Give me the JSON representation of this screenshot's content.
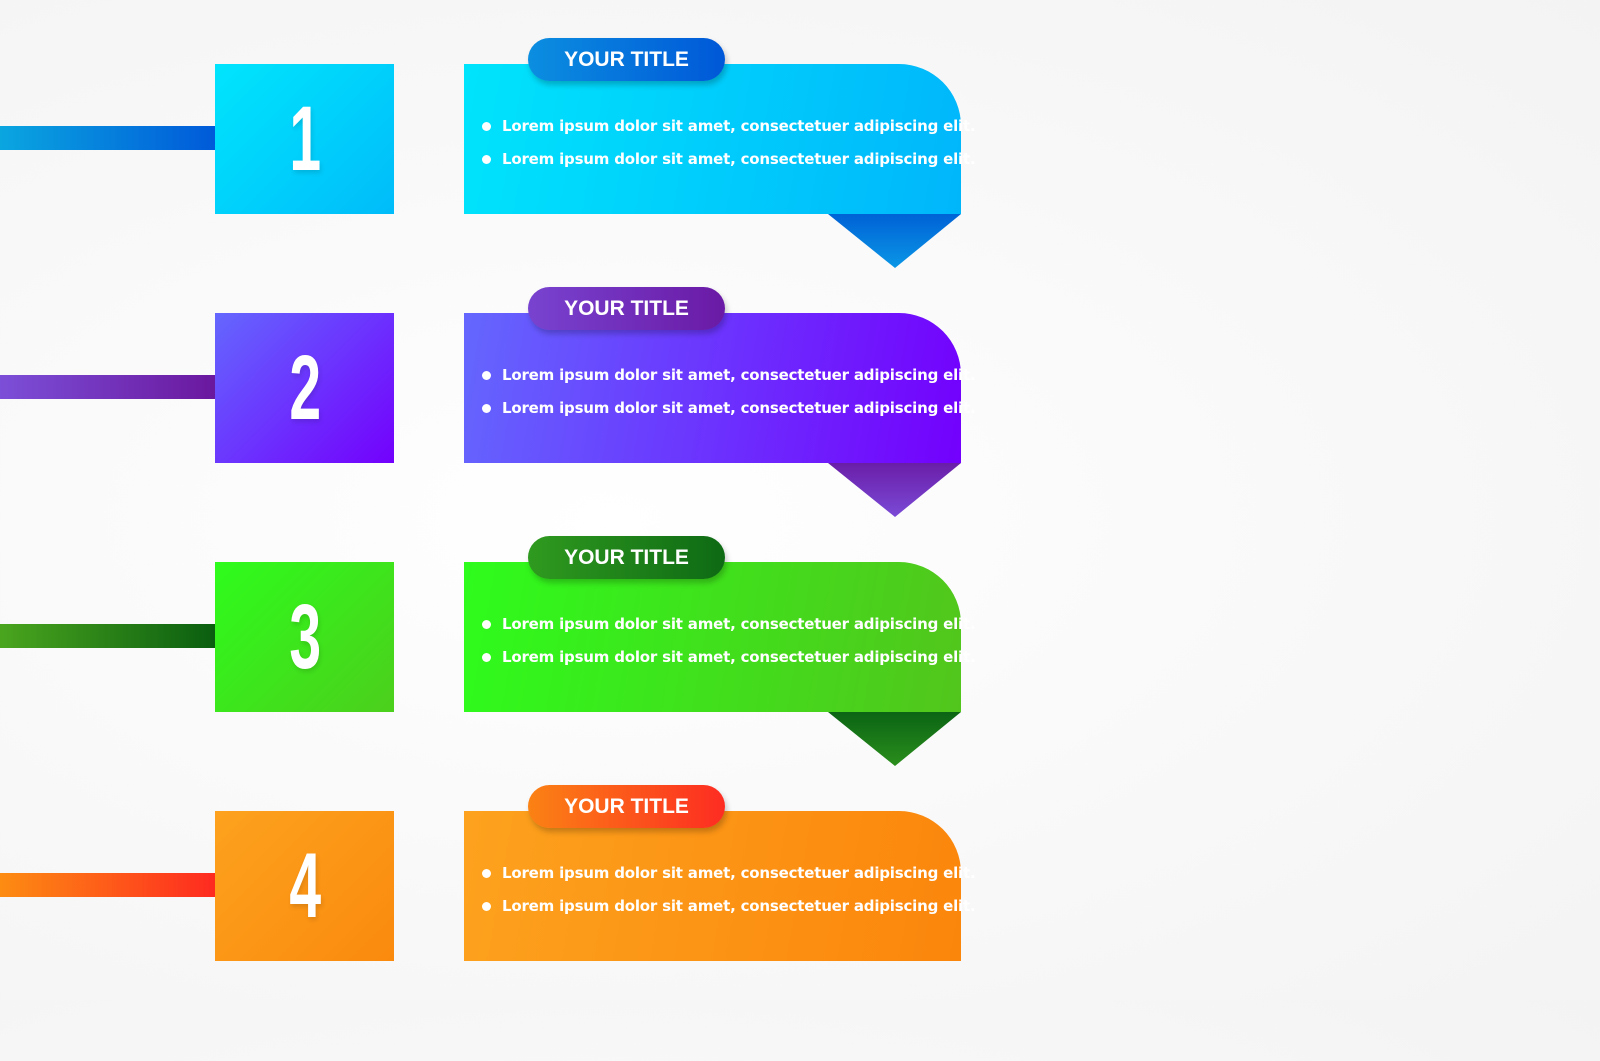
{
  "steps": [
    {
      "number": "1",
      "title": "YOUR TITLE",
      "bullets": [
        "Lorem ipsum dolor sit amet, consectetuer adipiscing elit.",
        "Lorem ipsum dolor sit amet, consectetuer adipiscing elit."
      ],
      "colors": {
        "box_start": "#00e5fd",
        "box_end": "#00bcfa",
        "card_start": "#00e4fc",
        "card_end": "#00b6fb",
        "pill_start": "#0b8ee0",
        "pill_end": "#0058d8",
        "line_start": "#0aa6e0",
        "line_end": "#005ad9",
        "tail_start": "#0062d6",
        "tail_end": "#0a96e6"
      },
      "has_tail": true
    },
    {
      "number": "2",
      "title": "YOUR TITLE",
      "bullets": [
        "Lorem ipsum dolor sit amet, consectetuer adipiscing elit.",
        "Lorem ipsum dolor sit amet, consectetuer adipiscing elit."
      ],
      "colors": {
        "box_start": "#6467fe",
        "box_end": "#7300fd",
        "card_start": "#6467fe",
        "card_end": "#7300fd",
        "pill_start": "#7843d0",
        "pill_end": "#6a1aa5",
        "line_start": "#7c4fd8",
        "line_end": "#6a189e",
        "tail_start": "#6a1ea8",
        "tail_end": "#7a4ad6"
      },
      "has_tail": true
    },
    {
      "number": "3",
      "title": "YOUR TITLE",
      "bullets": [
        "Lorem ipsum dolor sit amet, consectetuer adipiscing elit.",
        "Lorem ipsum dolor sit amet, consectetuer adipiscing elit."
      ],
      "colors": {
        "box_start": "#2efc1c",
        "box_end": "#4ccf1c",
        "card_start": "#2efc1c",
        "card_end": "#52c51c",
        "pill_start": "#2f9a1f",
        "pill_end": "#0e6a14",
        "line_start": "#4aa51e",
        "line_end": "#0a5e10",
        "tail_start": "#0b6414",
        "tail_end": "#2a8e1c"
      },
      "has_tail": true
    },
    {
      "number": "4",
      "title": "YOUR TITLE",
      "bullets": [
        "Lorem ipsum dolor sit amet, consectetuer adipiscing elit.",
        "Lorem ipsum dolor sit amet, consectetuer adipiscing elit."
      ],
      "colors": {
        "box_start": "#fda21e",
        "box_end": "#fa8a0e",
        "card_start": "#fda21e",
        "card_end": "#fb860c",
        "pill_start": "#fb8214",
        "pill_end": "#fd2c22",
        "line_start": "#fd8c12",
        "line_end": "#fe2a20",
        "tail_start": "#fb860c",
        "tail_end": "#fb860c"
      },
      "has_tail": false
    }
  ]
}
